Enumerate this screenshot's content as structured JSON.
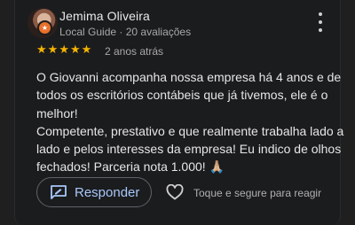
{
  "review": {
    "author": "Jemima Oliveira",
    "meta": "Local Guide · 20 avaliações",
    "badge_icon": "local-guide-star-badge",
    "rating": 5,
    "rating_max": 5,
    "star_color": "#f6b400",
    "time": "2 anos atrás",
    "text_lines": [
      "O Giovanni acompanha nossa empresa há 4 anos e de todos os escritórios contábeis que já tivemos, ele é o melhor!",
      "Competente, prestativo e que realmente trabalha lado a lado e pelos interesses da empresa! Eu indico de olhos fechados! Parceria nota 1.000! 🙏🏼"
    ]
  },
  "actions": {
    "reply_label": "Responder",
    "react_hint": "Toque e segure para reagir"
  },
  "colors": {
    "accent": "#a8c7fa",
    "badge": "#e8712b",
    "background": "#1b1c1e"
  }
}
